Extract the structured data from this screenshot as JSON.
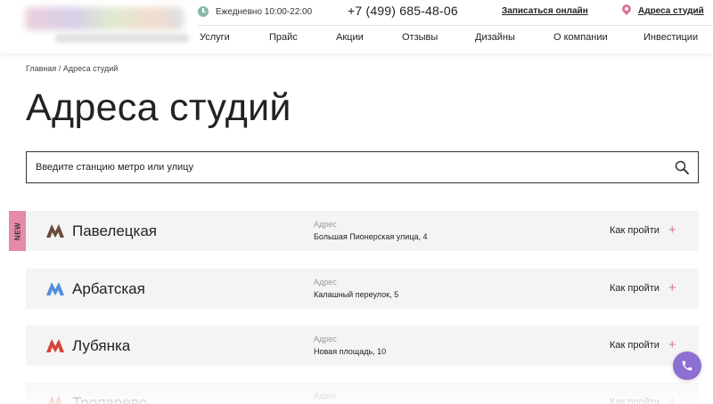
{
  "header": {
    "hours": "Ежедневно 10:00-22:00",
    "phone": "+7 (499) 685-48-06",
    "signup_link": "Записаться онлайн",
    "addresses_link": "Адреса студий",
    "icons": [
      "clock-icon",
      "pin-icon"
    ],
    "nav": [
      "Услуги",
      "Прайс",
      "Акции",
      "Отзывы",
      "Дизайны",
      "О компании",
      "Инвестиции"
    ]
  },
  "breadcrumb": {
    "home": "Главная",
    "separator": "/",
    "current": "Адреса студий"
  },
  "page_title": "Адреса студий",
  "search": {
    "placeholder": "Введите станцию метро или улицу",
    "icon": "search-icon"
  },
  "new_badge": "NEW",
  "studios": [
    {
      "station": "Павелецкая",
      "address_label": "Адрес",
      "address": "Большая Пионерская улица, 4",
      "route_label": "Как пройти",
      "metro_color": "#6b4a3a"
    },
    {
      "station": "Арбатская",
      "address_label": "Адрес",
      "address": "Калашный переулок, 5",
      "route_label": "Как пройти",
      "metro_color": "#4f8fe0"
    },
    {
      "station": "Лубянка",
      "address_label": "Адрес",
      "address": "Новая площадь, 10",
      "route_label": "Как пройти",
      "metro_color": "#d9443b"
    },
    {
      "station": "Тропарево",
      "address_label": "Адрес",
      "address": "",
      "route_label": "Как пройти",
      "metro_color": "#d9443b"
    }
  ],
  "colors": {
    "accent_pink": "#d9739b",
    "call_button": "#8d6fd1",
    "card_bg": "#f4f4f4"
  },
  "call_button_icon": "phone-icon"
}
